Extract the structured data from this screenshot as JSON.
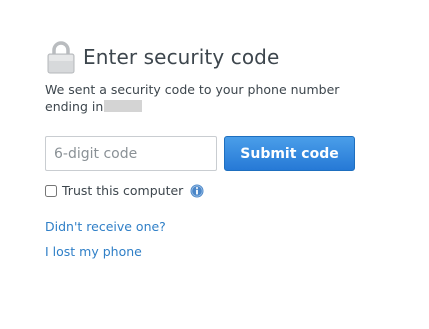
{
  "header": {
    "title": "Enter security code",
    "icon": "lock-icon"
  },
  "description": {
    "text": "We sent a security code to your phone number ending in",
    "phone_suffix_redacted": true
  },
  "code_input": {
    "placeholder": "6-digit code",
    "value": ""
  },
  "submit": {
    "label": "Submit code",
    "color": "#2b7fd8"
  },
  "trust": {
    "label": "Trust this computer",
    "checked": false,
    "info_icon": "info-icon"
  },
  "links": {
    "didnt_receive": "Didn't receive one?",
    "lost_phone": "I lost my phone",
    "color": "#2f7fc7"
  }
}
